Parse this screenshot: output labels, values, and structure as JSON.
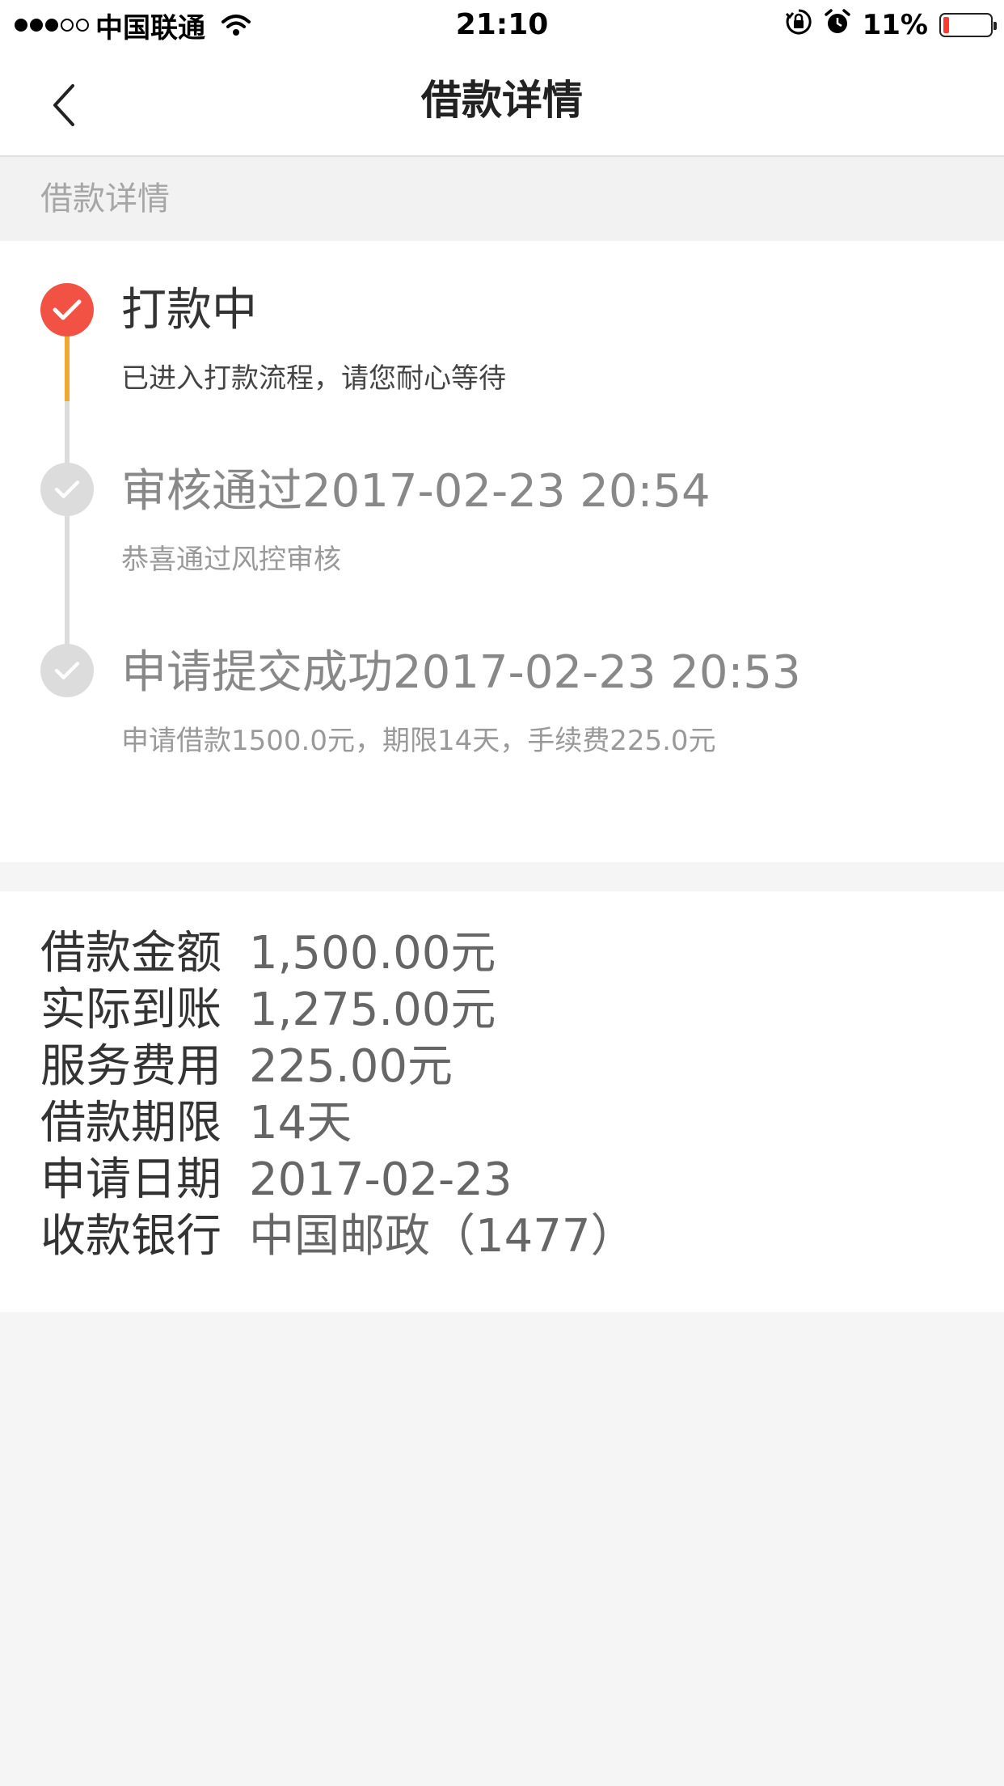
{
  "status_bar": {
    "carrier": "中国联通",
    "time": "21:10",
    "battery_pct": "11%",
    "battery_level": 0.11,
    "signal_bars_total": 5,
    "signal_bars_filled": 3
  },
  "nav": {
    "title": "借款详情",
    "back_icon": "chevron-left-icon"
  },
  "section_header": "借款详情",
  "timeline": [
    {
      "title": "打款中",
      "description": "已进入打款流程，请您耐心等待",
      "state": "active"
    },
    {
      "title": "审核通过2017-02-23 20:54",
      "description": "恭喜通过风控审核",
      "state": "done"
    },
    {
      "title": "申请提交成功2017-02-23 20:53",
      "description": "申请借款1500.0元，期限14天，手续费225.0元",
      "state": "done"
    }
  ],
  "details": [
    {
      "label": "借款金额",
      "value": "1,500.00元"
    },
    {
      "label": "实际到账",
      "value": "1,275.00元"
    },
    {
      "label": "服务费用",
      "value": "225.00元"
    },
    {
      "label": "借款期限",
      "value": "14天"
    },
    {
      "label": "申请日期",
      "value": "2017-02-23"
    },
    {
      "label": "收款银行",
      "value": "中国邮政（1477）"
    }
  ],
  "colors": {
    "active_marker": "#f25244",
    "active_line": "#f0a830",
    "inactive_marker": "#dcdcdc",
    "battery_low": "#ff3b30"
  }
}
